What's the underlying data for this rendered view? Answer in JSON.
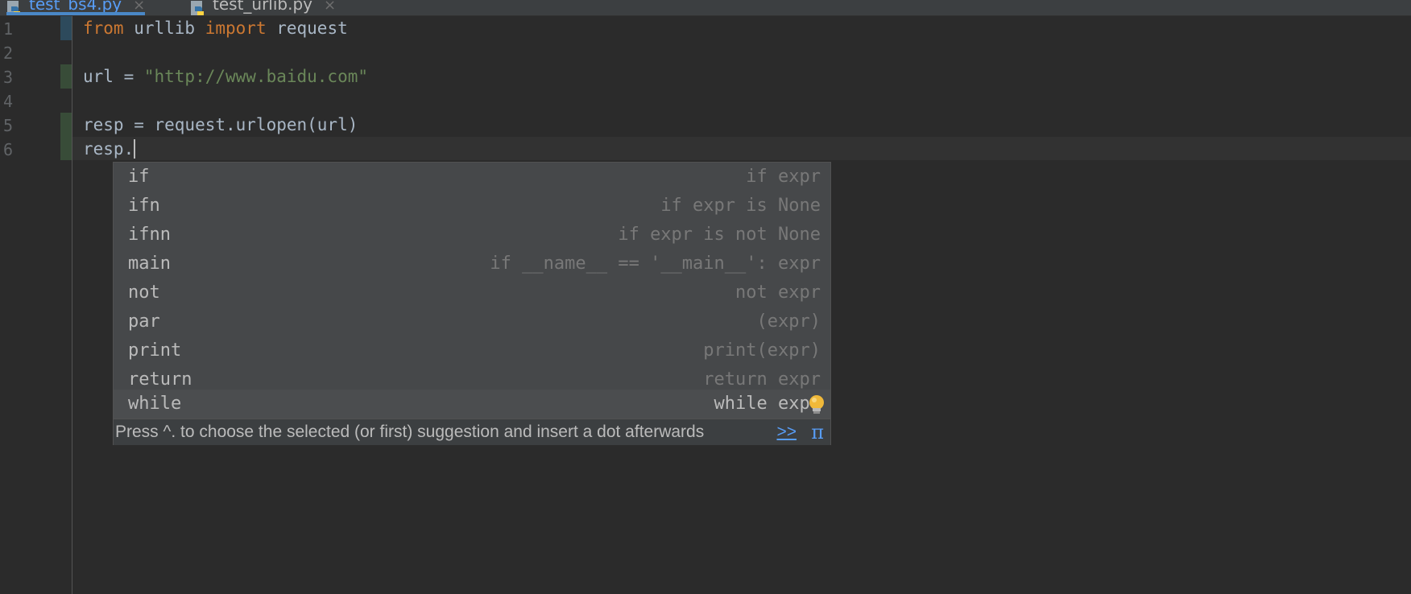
{
  "tabs": [
    {
      "label": "test_bs4.py",
      "active": true
    },
    {
      "label": "test_urlib.py",
      "active": false
    }
  ],
  "gutter": {
    "line_numbers": [
      "1",
      "2",
      "3",
      "4",
      "5",
      "6"
    ]
  },
  "editor": {
    "line1": {
      "kw_from": "from",
      "module": " urllib ",
      "kw_import": "import",
      "name": " request"
    },
    "line3": {
      "lhs": "url = ",
      "string": "\"http://www.baidu.com\""
    },
    "line5": {
      "text": "resp = request.urlopen(url)"
    },
    "line6": {
      "text": "resp."
    }
  },
  "completion": {
    "items": [
      {
        "name": "if",
        "desc": "if expr"
      },
      {
        "name": "ifn",
        "desc": "if expr is None"
      },
      {
        "name": "ifnn",
        "desc": "if expr is not None"
      },
      {
        "name": "main",
        "desc": "if __name__ == '__main__': expr"
      },
      {
        "name": "not",
        "desc": "not expr"
      },
      {
        "name": "par",
        "desc": "(expr)"
      },
      {
        "name": "print",
        "desc": "print(expr)"
      },
      {
        "name": "return",
        "desc": "return expr"
      },
      {
        "name": "while",
        "desc": "while expr"
      }
    ],
    "selected_index": 8,
    "hint": "Press ^. to choose the selected (or first) suggestion and insert a dot afterwards",
    "more_link": ">>",
    "pi_symbol": "π"
  },
  "colors": {
    "keyword": "#cc7832",
    "string": "#6a8759",
    "text": "#a9b7c6",
    "link": "#589df6"
  },
  "icons": [
    "python-file-icon",
    "close-icon",
    "lightbulb-icon"
  ]
}
